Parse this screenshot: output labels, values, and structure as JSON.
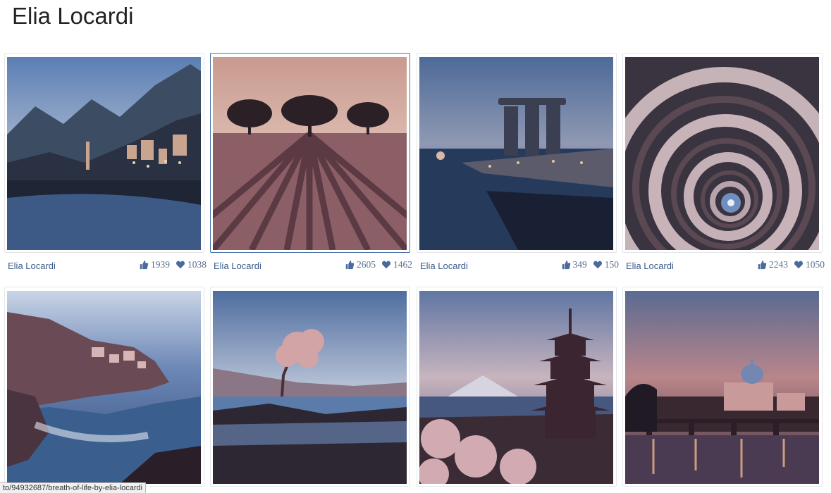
{
  "page": {
    "title": "Elia Locardi"
  },
  "photos": [
    {
      "author": "Elia Locardi",
      "likes": "1939",
      "favorites": "1038",
      "scene": "alpine-lake-village"
    },
    {
      "author": "Elia Locardi",
      "likes": "2605",
      "favorites": "1462",
      "scene": "lavender-field-trees"
    },
    {
      "author": "Elia Locardi",
      "likes": "349",
      "favorites": "150",
      "scene": "singapore-skyline"
    },
    {
      "author": "Elia Locardi",
      "likes": "2243",
      "favorites": "1050",
      "scene": "spiral-staircase"
    },
    {
      "scene": "coastal-cliff-village"
    },
    {
      "scene": "lone-tree-reflection"
    },
    {
      "scene": "pagoda-mountain"
    },
    {
      "scene": "dome-bridge-night"
    }
  ],
  "status_bar": {
    "url": "to/94932687/breath-of-life-by-elia-locardi"
  },
  "colors": {
    "link": "#3b5c8c",
    "stats": "#5b6f8f",
    "active_border": "#4a72a8"
  }
}
